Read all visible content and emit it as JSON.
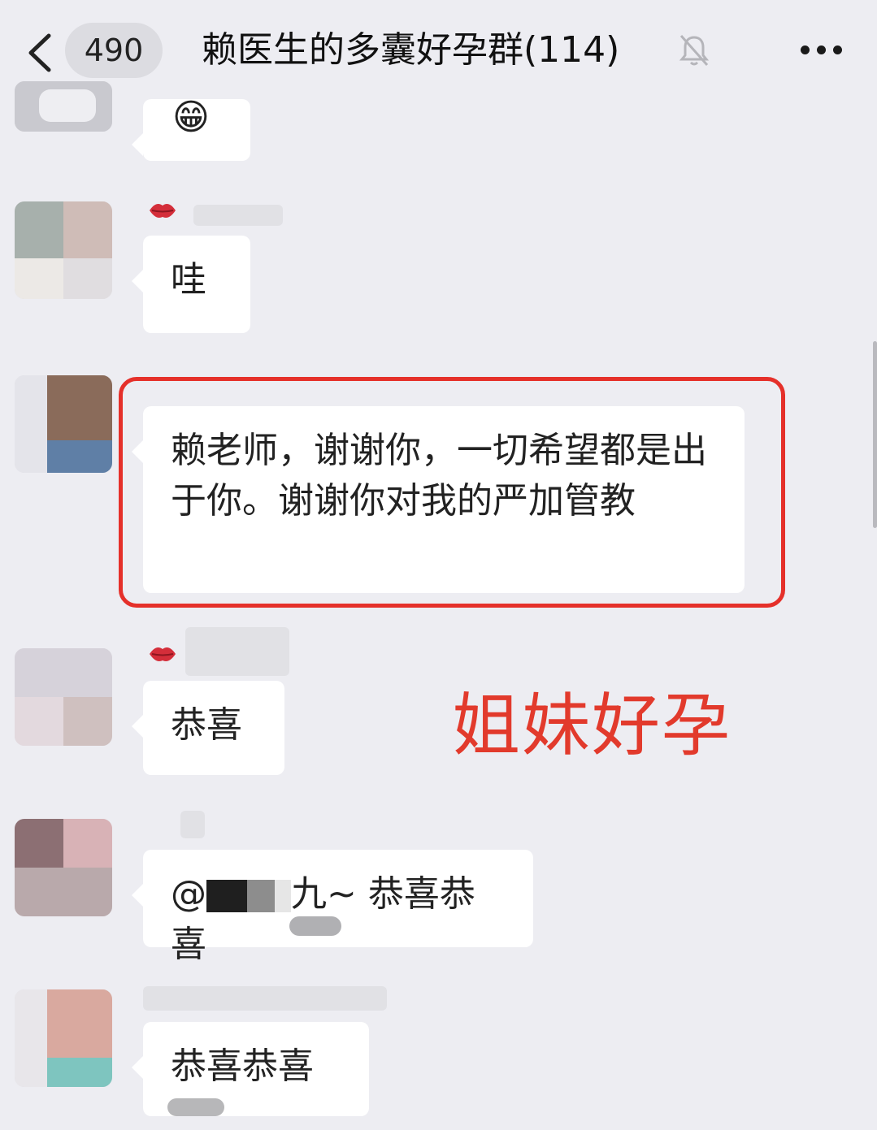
{
  "header": {
    "unread_count": "490",
    "title": "赖医生的多囊好孕群(114)",
    "back_icon": "chevron-left-icon",
    "mute_icon": "bell-muted-icon",
    "more_icon": "more-dots-icon"
  },
  "messages": [
    {
      "text": "😁"
    },
    {
      "text": "哇"
    },
    {
      "text": "赖老师，谢谢你，一切希望都是出于你。谢谢你对我的严加管教"
    },
    {
      "text": "恭喜"
    },
    {
      "mention_prefix": "@",
      "mention_suffix": "九~",
      "text": "恭喜恭喜"
    },
    {
      "text": "恭喜恭喜"
    }
  ],
  "overlay": {
    "caption": "姐妹好孕",
    "color": "#e23a2c"
  },
  "colors": {
    "background": "#ededf2",
    "bubble": "#ffffff",
    "highlight": "#e5302a"
  }
}
